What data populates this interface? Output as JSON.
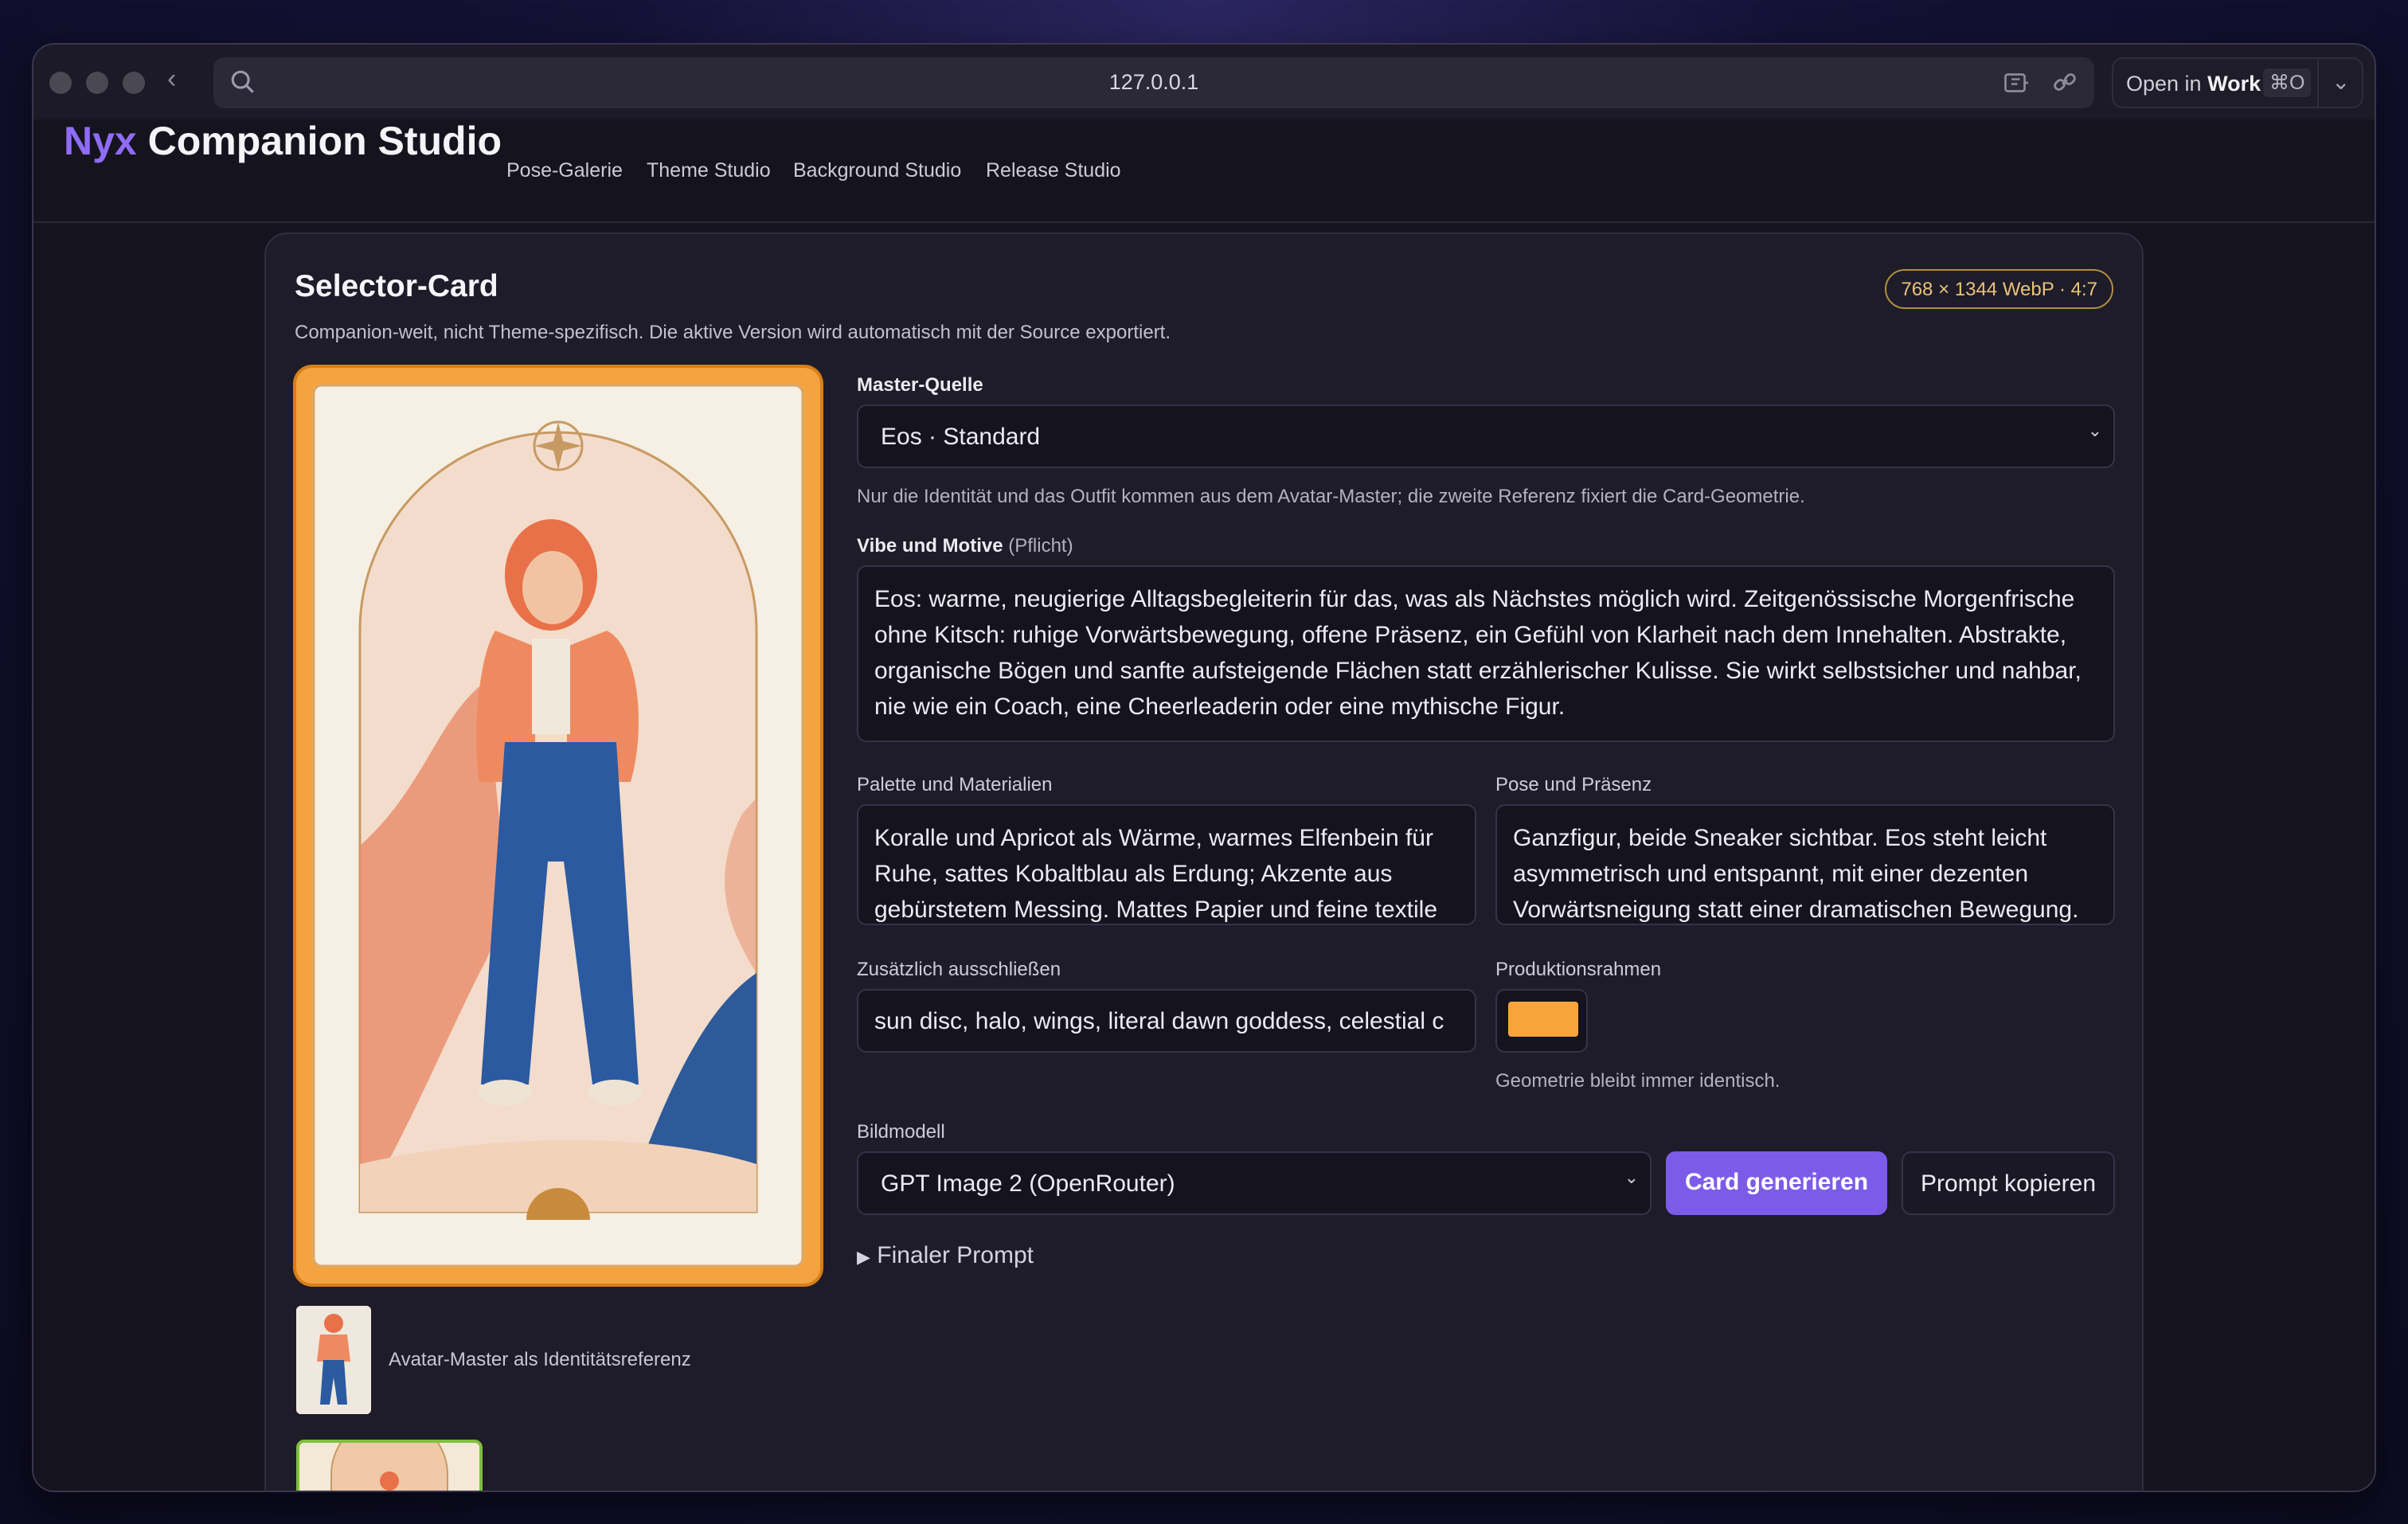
{
  "browser": {
    "url": "127.0.0.1",
    "open_in_prefix": "Open in",
    "open_in_target": "Work",
    "open_in_shortcut": "⌘O"
  },
  "app": {
    "brand_first": "Nyx",
    "brand_rest": "Companion Studio",
    "nav": [
      "Pose-Galerie",
      "Theme Studio",
      "Background Studio",
      "Release Studio"
    ]
  },
  "card": {
    "title": "Selector-Card",
    "subtitle": "Companion-weit, nicht Theme-spezifisch. Die aktive Version wird automatisch mit der Source exportiert.",
    "badge": "768 × 1344 WebP · 4:7",
    "master_label": "Master-Quelle",
    "master_value": "Eos · Standard",
    "master_help": "Nur die Identität und das Outfit kommen aus dem Avatar-Master; die zweite Referenz fixiert die Card-Geometrie.",
    "vibe_label": "Vibe und Motive",
    "vibe_required": "(Pflicht)",
    "vibe_value": "Eos: warme, neugierige Alltagsbegleiterin für das, was als Nächstes möglich wird. Zeitgenössische Morgenfrische ohne Kitsch: ruhige Vorwärtsbewegung, offene Präsenz, ein Gefühl von Klarheit nach dem Innehalten. Abstrakte, organische Bögen und sanfte aufsteigende Flächen statt erzählerischer Kulisse. Sie wirkt selbstsicher und nahbar, nie wie ein Coach, eine Cheerleaderin oder eine mythische Figur.",
    "palette_label": "Palette und Materialien",
    "palette_value": "Koralle und Apricot als Wärme, warmes Elfenbein für Ruhe, sattes Kobaltblau als Erdung; Akzente aus gebürstetem Messing. Mattes Papier und feine textile",
    "pose_label": "Pose und Präsenz",
    "pose_value": "Ganzfigur, beide Sneaker sichtbar. Eos steht leicht asymmetrisch und entspannt, mit einer dezenten Vorwärtsneigung statt einer dramatischen Bewegung.",
    "exclude_label": "Zusätzlich ausschließen",
    "exclude_value": "sun disc, halo, wings, literal dawn goddess, celestial c",
    "frame_label": "Produktionsrahmen",
    "frame_color": "#f7a53b",
    "frame_help": "Geometrie bleibt immer identisch.",
    "model_label": "Bildmodell",
    "model_value": "GPT Image 2 (OpenRouter)",
    "generate_label": "Card generieren",
    "copy_label": "Prompt kopieren",
    "final_prompt_label": "Finaler Prompt",
    "avatar_ref_label": "Avatar-Master als Identitätsreferenz"
  },
  "colors": {
    "accent": "#7c5be8",
    "brand_accent": "#8f6cf5",
    "frame_orange": "#f5a340",
    "badge_gold": "#e9c37a"
  }
}
